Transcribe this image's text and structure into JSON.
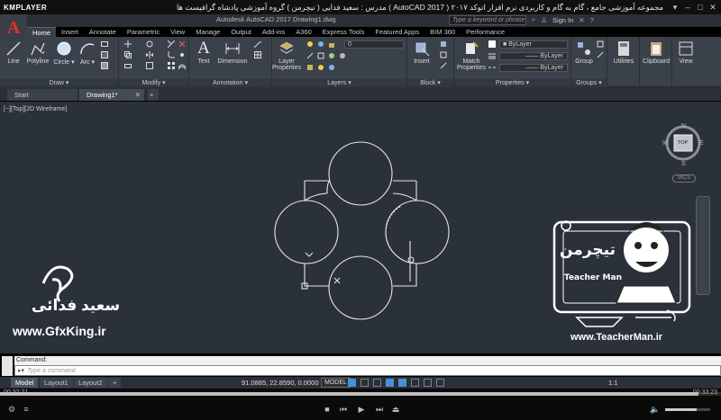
{
  "player": {
    "logo": "KMPLAYER",
    "title": "مجموعه آموزشی جامع ، گام به گام و کاربردی نرم افزار اتوکد ۲۰۱۷ ( AutoCAD 2017 )  مدرس : سعید فدایی ( تیچرمن ) گروه آموزشی پادشاه گرافیست ها",
    "time_elapsed": "00:32:21",
    "time_total": "00:33:23",
    "progress": 0.969
  },
  "acad": {
    "title": "Autodesk AutoCAD 2017    Drawing1.dwg",
    "search_placeholder": "Type a keyword or phrase",
    "sign_in": "Sign In",
    "tabs": [
      "Home",
      "Insert",
      "Annotate",
      "Parametric",
      "View",
      "Manage",
      "Output",
      "Add-ins",
      "A360",
      "Express Tools",
      "Featured Apps",
      "BIM 360",
      "Performance"
    ],
    "panels": {
      "draw": "Draw",
      "modify": "Modify",
      "annotation": "Annotation",
      "layers": "Layers",
      "block": "Block",
      "properties": "Properties",
      "groups": "Groups"
    },
    "tools": {
      "line": "Line",
      "polyline": "Polyline",
      "circle": "Circle",
      "arc": "Arc",
      "text": "Text",
      "dimension": "Dimension",
      "layer_properties_1": "Layer",
      "layer_properties_2": "Properties",
      "insert": "Insert",
      "match_properties_1": "Match",
      "match_properties_2": "Properties",
      "group": "Group",
      "utilities": "Utilities",
      "clipboard": "Clipboard",
      "view": "View"
    },
    "layer_value": "0",
    "bylayer_1": "ByLayer",
    "bylayer_2": "ByLayer",
    "bylayer_3": "ByLayer",
    "file_tabs": {
      "start": "Start",
      "drawing": "Drawing1*"
    },
    "viewport_label": "[−][Top][2D Wireframe]",
    "viewcube": {
      "n": "N",
      "s": "S",
      "e": "E",
      "w": "W",
      "top": "TOP",
      "wcs": "WCS"
    },
    "command_history": "Command:",
    "command_placeholder": "Type a command",
    "layout_tabs": [
      "Model",
      "Layout1",
      "Layout2"
    ],
    "coords": "91.0885, 22.8590, 0.0000",
    "model_button": "MODEL",
    "scale": "1:1"
  },
  "watermark": {
    "name_fa": "سعید فدائی",
    "site_left": "www.GfxKing.ir",
    "site_right": "www.TeacherMan.ir",
    "badge_title": "تیچرمن",
    "badge_sub": "Teacher Man"
  }
}
